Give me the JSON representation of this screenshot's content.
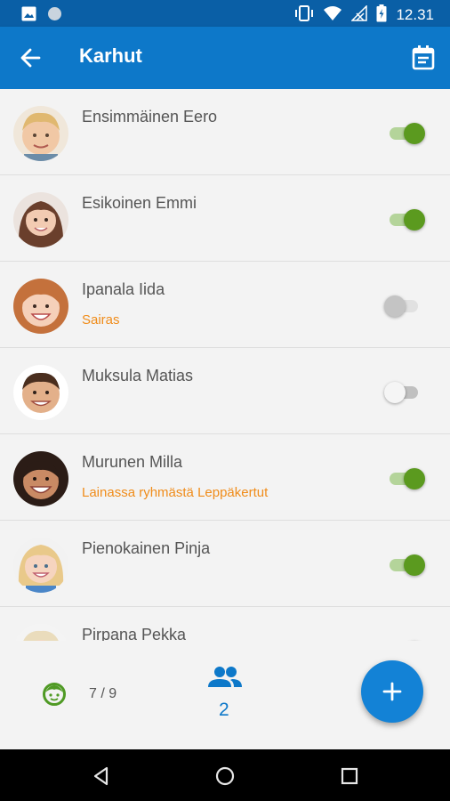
{
  "status_bar": {
    "time": "12.31",
    "icons": [
      "image-icon",
      "circle-icon",
      "vibrate-icon",
      "wifi-icon",
      "no-signal-icon",
      "battery-icon"
    ]
  },
  "app_bar": {
    "title": "Karhut",
    "back_icon": "arrow-left-icon",
    "calendar_icon": "calendar-icon"
  },
  "children": [
    {
      "name": "Ensimmäinen Eero",
      "subtitle": "",
      "present": true
    },
    {
      "name": "Esikoinen Emmi",
      "subtitle": "",
      "present": true
    },
    {
      "name": "Ipanala Iida",
      "subtitle": "Sairas",
      "present": false
    },
    {
      "name": "Muksula Matias",
      "subtitle": "",
      "present": false
    },
    {
      "name": "Murunen Milla",
      "subtitle": "Lainassa ryhmästä Leppäkertut",
      "present": true
    },
    {
      "name": "Pienokainen Pinja",
      "subtitle": "",
      "present": true
    },
    {
      "name": "Pirpana Pekka",
      "subtitle": "",
      "present": true
    }
  ],
  "bottom_bar": {
    "kid_count": "7 / 9",
    "group_count": "2",
    "fab_icon": "plus-icon"
  },
  "colors": {
    "primary": "#0d78c9",
    "status_bar": "#0a5fa6",
    "accent_green": "#5b9a1f",
    "warning_orange": "#f08c1a"
  }
}
